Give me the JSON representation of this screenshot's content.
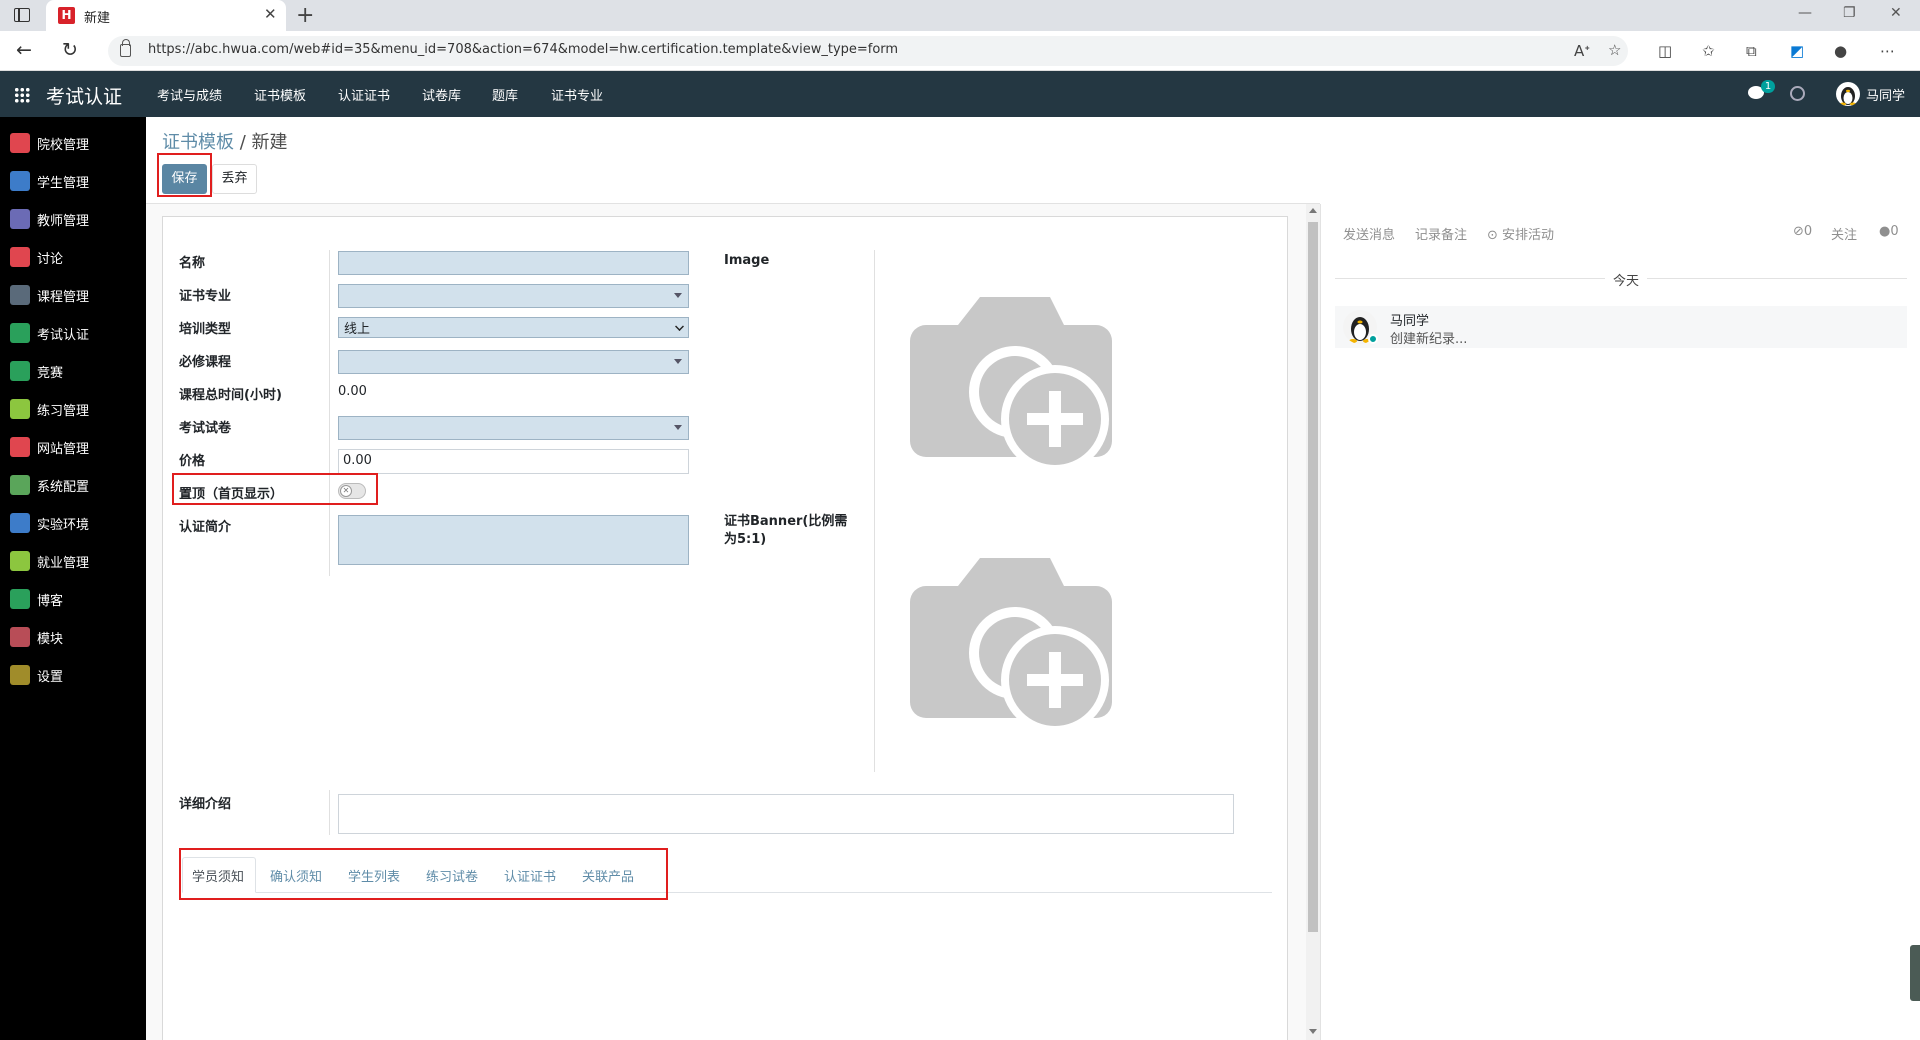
{
  "browser": {
    "tab_title": "新建",
    "url": "https://abc.hwua.com/web#id=35&menu_id=708&action=674&model=hw.certification.template&view_type=form"
  },
  "app": {
    "brand": "考试认证",
    "menu": [
      "考试与成绩",
      "证书模板",
      "认证证书",
      "试卷库",
      "题库",
      "证书专业"
    ],
    "chat_badge": "1",
    "user_name": "马同学"
  },
  "sidebar": {
    "items": [
      {
        "label": "院校管理",
        "icon": "school-icon",
        "color": "#e0464f"
      },
      {
        "label": "学生管理",
        "icon": "student-icon",
        "color": "#3d7cc9"
      },
      {
        "label": "教师管理",
        "icon": "teacher-icon",
        "color": "#6b6bb5"
      },
      {
        "label": "讨论",
        "icon": "discuss-icon",
        "color": "#e0464f"
      },
      {
        "label": "课程管理",
        "icon": "course-icon",
        "color": "#5a6a7a"
      },
      {
        "label": "考试认证",
        "icon": "certification-icon",
        "color": "#2aa05b"
      },
      {
        "label": "竞赛",
        "icon": "cloud-icon",
        "color": "#2aa05b"
      },
      {
        "label": "练习管理",
        "icon": "practice-icon",
        "color": "#8cc63f"
      },
      {
        "label": "网站管理",
        "icon": "website-icon",
        "color": "#e0464f"
      },
      {
        "label": "系统配置",
        "icon": "wrench-icon",
        "color": "#5aa55a"
      },
      {
        "label": "实验环境",
        "icon": "lab-icon",
        "color": "#3d7cc9"
      },
      {
        "label": "就业管理",
        "icon": "employment-icon",
        "color": "#8cc63f"
      },
      {
        "label": "博客",
        "icon": "blog-icon",
        "color": "#2aa05b"
      },
      {
        "label": "模块",
        "icon": "modules-icon",
        "color": "#b84d57"
      },
      {
        "label": "设置",
        "icon": "settings-icon",
        "color": "#a08c2a"
      }
    ]
  },
  "breadcrumb": {
    "parent": "证书模板",
    "separator": " / ",
    "current": "新建"
  },
  "buttons": {
    "save": "保存",
    "discard": "丢弃"
  },
  "form": {
    "name_label": "名称",
    "major_label": "证书专业",
    "training_type_label": "培训类型",
    "training_type_value": "线上",
    "required_course_label": "必修课程",
    "total_hours_label": "课程总时间(小时)",
    "total_hours_value": "0.00",
    "exam_paper_label": "考试试卷",
    "price_label": "价格",
    "price_value": "0.00",
    "pin_top_label": "置顶（首页显示）",
    "pin_top_value": false,
    "intro_label": "认证简介",
    "image_label": "Image",
    "banner_label": "证书Banner(比例需为5:1)",
    "detail_label": "详细介绍"
  },
  "form_tabs": [
    "学员须知",
    "确认须知",
    "学生列表",
    "练习试卷",
    "认证证书",
    "关联产品"
  ],
  "chatter": {
    "send_message": "发送消息",
    "log_note": "记录备注",
    "schedule_activity": "安排活动",
    "attachments_count": "0",
    "follow": "关注",
    "followers_count": "0",
    "today_label": "今天",
    "message_author": "马同学",
    "message_body": "创建新纪录..."
  },
  "colors": {
    "app_nav": "#243742",
    "primary": "#5a86a3",
    "highlight_border": "#e01e1e",
    "field_required": "#d2e1ec"
  }
}
